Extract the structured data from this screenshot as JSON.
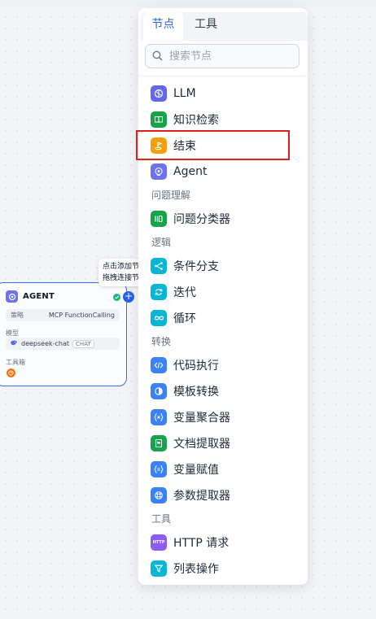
{
  "tabs": {
    "nodes": "节点",
    "tools": "工具"
  },
  "search": {
    "placeholder": "搜索节点"
  },
  "items": {
    "llm": "LLM",
    "knowledge": "知识检索",
    "end": "结束",
    "agent": "Agent",
    "classifier": "问题分类器",
    "ifelse": "条件分支",
    "iteration": "迭代",
    "loop": "循环",
    "code": "代码执行",
    "template": "模板转换",
    "aggregator": "变量聚合器",
    "docextract": "文档提取器",
    "assigner": "变量赋值",
    "paramextract": "参数提取器",
    "http": "HTTP 请求",
    "listop": "列表操作"
  },
  "sections": {
    "understanding": "问题理解",
    "logic": "逻辑",
    "transform": "转换",
    "tools": "工具"
  },
  "agent_node": {
    "title": "AGENT",
    "strategy_key": "策略",
    "strategy_value": "MCP FunctionCalling",
    "model_label": "模型",
    "model_name": "deepseek-chat",
    "model_tag": "CHAT",
    "tools_label": "工具箱"
  },
  "tooltip": {
    "line1": "点击添加节",
    "line2": "拖拽连接节"
  },
  "colors": {
    "accent": "#2563eb",
    "highlight": "#e11d1d",
    "llm": "#6366f1",
    "knowledge": "#16a34a",
    "end": "#f59e0b",
    "agent": "#6b73f0",
    "classifier": "#16a34a",
    "logic": "#06b6d4",
    "code": "#3b82f6",
    "http": "#8b5cf6"
  }
}
